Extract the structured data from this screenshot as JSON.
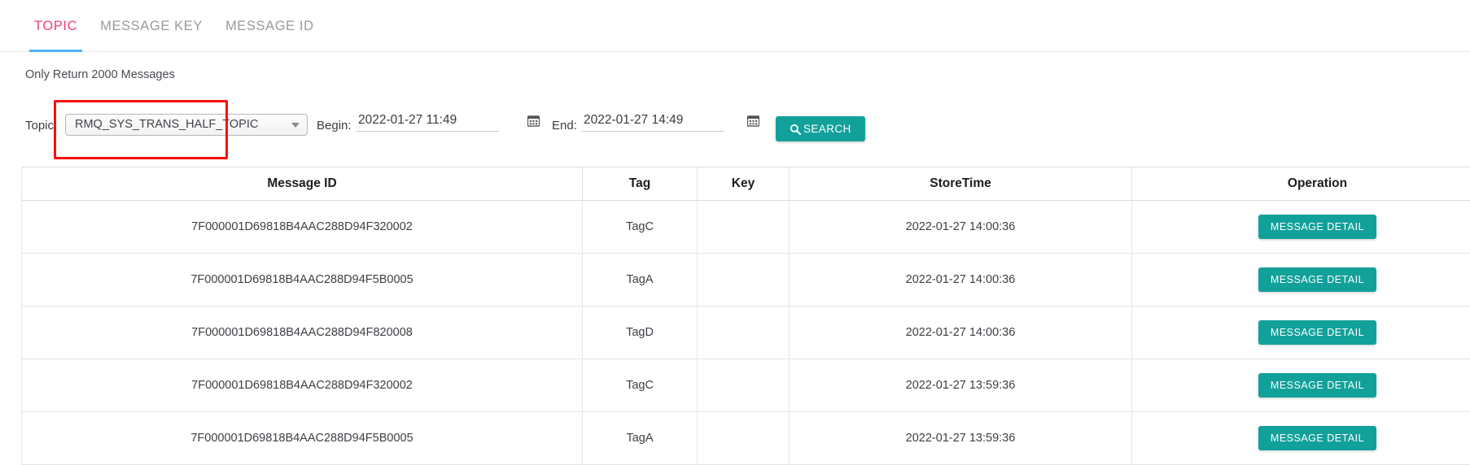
{
  "tabs": [
    {
      "label": "TOPIC",
      "active": true
    },
    {
      "label": "MESSAGE KEY",
      "active": false
    },
    {
      "label": "MESSAGE ID",
      "active": false
    }
  ],
  "notice": "Only Return 2000 Messages",
  "filters": {
    "topic_label": "Topic:",
    "topic_value": "RMQ_SYS_TRANS_HALF_TOPIC",
    "begin_label": "Begin:",
    "begin_value": "2022-01-27 11:49",
    "end_label": "End:",
    "end_value": "2022-01-27 14:49",
    "search_label": "SEARCH",
    "search_icon": "magnifier-icon",
    "calendar_icon": "calendar-icon",
    "dropdown_icon": "chevron-down-icon"
  },
  "colors": {
    "accent_teal": "#12a19a",
    "tab_active": "#ec407a",
    "tab_underline": "#4fb4f7",
    "highlight_box": "#fb0d0d"
  },
  "table": {
    "columns": [
      "Message ID",
      "Tag",
      "Key",
      "StoreTime",
      "Operation"
    ],
    "action_label": "MESSAGE DETAIL",
    "rows": [
      {
        "message_id": "7F000001D69818B4AAC288D94F320002",
        "tag": "TagC",
        "key": "",
        "store_time": "2022-01-27 14:00:36"
      },
      {
        "message_id": "7F000001D69818B4AAC288D94F5B0005",
        "tag": "TagA",
        "key": "",
        "store_time": "2022-01-27 14:00:36"
      },
      {
        "message_id": "7F000001D69818B4AAC288D94F820008",
        "tag": "TagD",
        "key": "",
        "store_time": "2022-01-27 14:00:36"
      },
      {
        "message_id": "7F000001D69818B4AAC288D94F320002",
        "tag": "TagC",
        "key": "",
        "store_time": "2022-01-27 13:59:36"
      },
      {
        "message_id": "7F000001D69818B4AAC288D94F5B0005",
        "tag": "TagA",
        "key": "",
        "store_time": "2022-01-27 13:59:36"
      }
    ]
  }
}
